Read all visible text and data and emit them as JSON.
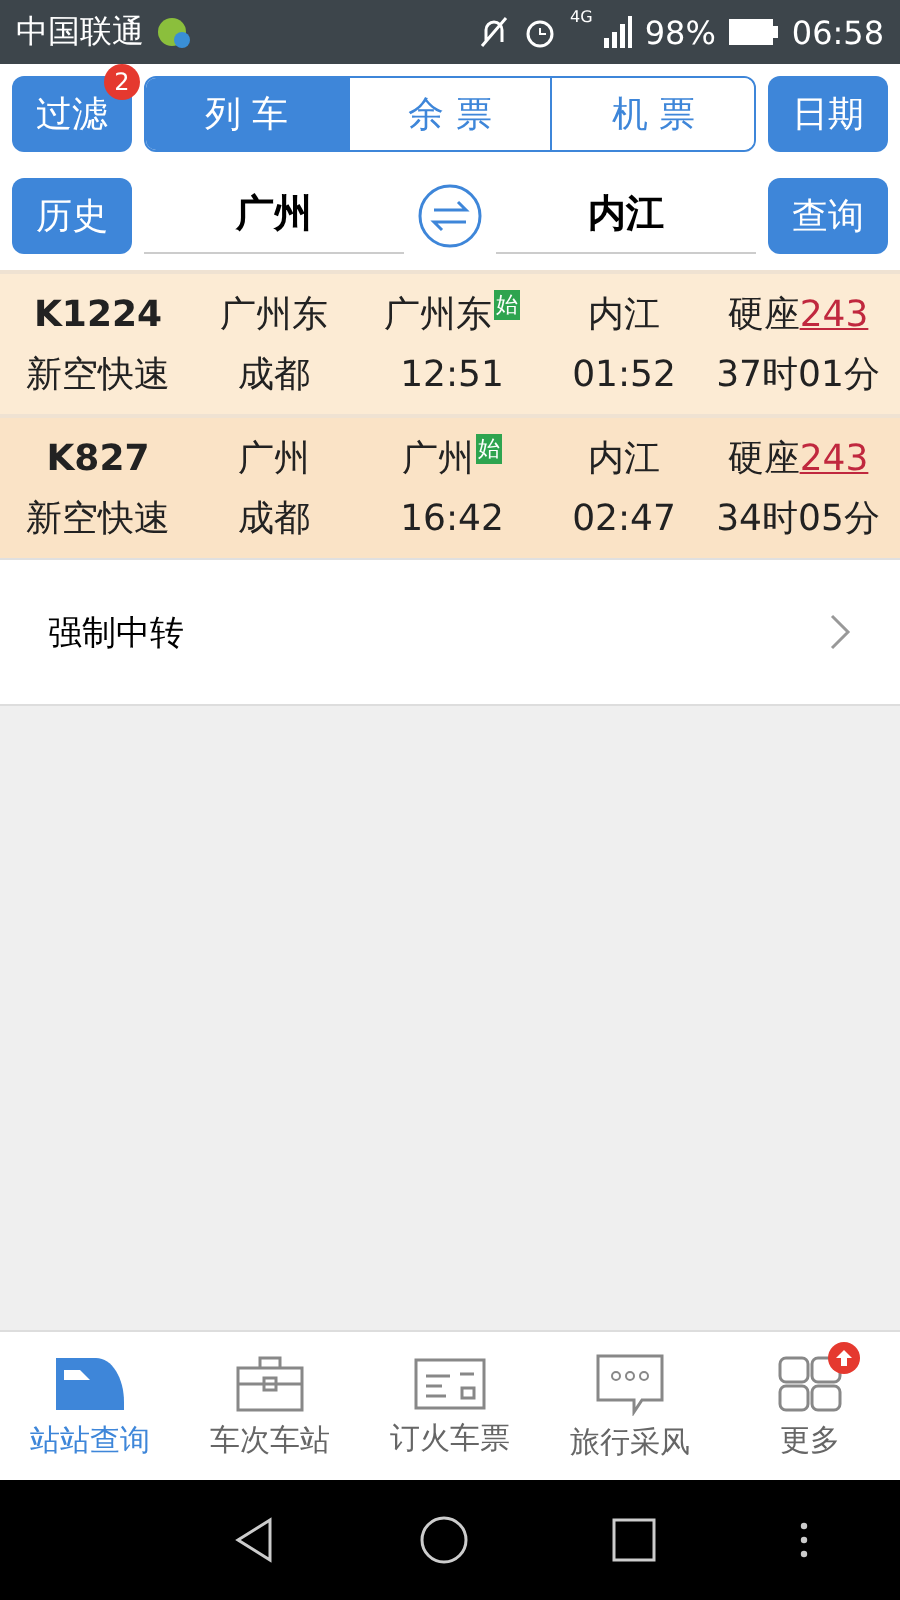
{
  "status_bar": {
    "carrier": "中国联通",
    "network": "4G",
    "battery": "98%",
    "time": "06:58"
  },
  "toolbar": {
    "filter_button": {
      "label": "过滤",
      "badge": "2"
    },
    "segments": [
      {
        "label": "列 车",
        "selected": true
      },
      {
        "label": "余 票",
        "selected": false
      },
      {
        "label": "机 票",
        "selected": false
      }
    ],
    "date_button": "日期"
  },
  "route": {
    "history_button": "历史",
    "from": "广州",
    "to": "内江",
    "query_button": "查询"
  },
  "trains": [
    {
      "number": "K1224",
      "type": "新空快速",
      "board_station": "广州东",
      "terminal": "成都",
      "depart_station": "广州东",
      "start_badge": "始",
      "depart_time": "12:51",
      "arrive_station": "内江",
      "arrive_time": "01:52",
      "seat": "硬座",
      "seat_count": "243",
      "duration": "37时01分"
    },
    {
      "number": "K827",
      "type": "新空快速",
      "board_station": "广州",
      "terminal": "成都",
      "depart_station": "广州",
      "start_badge": "始",
      "depart_time": "16:42",
      "arrive_station": "内江",
      "arrive_time": "02:47",
      "seat": "硬座",
      "seat_count": "243",
      "duration": "34时05分"
    }
  ],
  "transfer_row": {
    "label": "强制中转"
  },
  "tab_bar": [
    {
      "label": "站站查询",
      "kind": "train",
      "selected": true,
      "badge": false
    },
    {
      "label": "车次车站",
      "kind": "briefcase",
      "selected": false,
      "badge": false
    },
    {
      "label": "订火车票",
      "kind": "ticket",
      "selected": false,
      "badge": false
    },
    {
      "label": "旅行采风",
      "kind": "chat",
      "selected": false,
      "badge": false
    },
    {
      "label": "更多",
      "kind": "grid",
      "selected": false,
      "badge": true
    }
  ]
}
